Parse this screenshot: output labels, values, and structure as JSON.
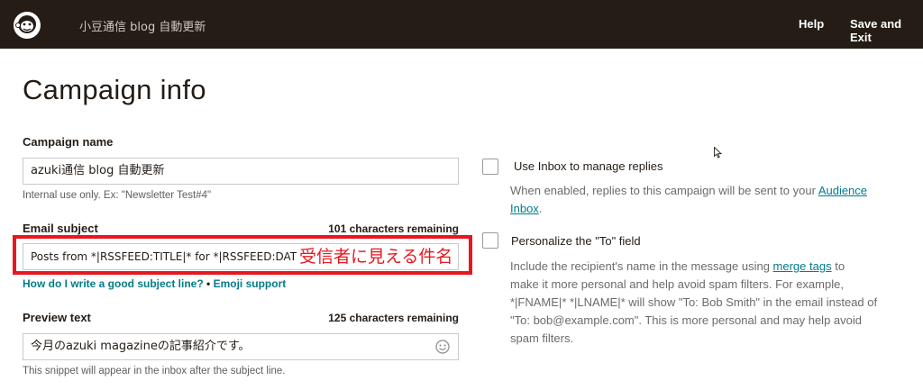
{
  "topbar": {
    "campaign_title": "小豆通信 blog 自動更新",
    "help_label": "Help",
    "save_exit_label": "Save and Exit",
    "logo_icon": "mailchimp-logo-icon"
  },
  "page_title": "Campaign info",
  "campaign_name": {
    "label": "Campaign name",
    "value": "azuki通信 blog 自動更新",
    "help": "Internal use only. Ex: \"Newsletter Test#4\""
  },
  "email_subject": {
    "label": "Email subject",
    "counter": "101 characters remaining",
    "value": "Posts from *|RSSFEED:TITLE|* for *|RSSFEED:DATE|*",
    "annotation": "受信者に見える件名",
    "help_link": "How do I write a good subject line?",
    "separator": " • ",
    "emoji_link": "Emoji support"
  },
  "preview_text": {
    "label": "Preview text",
    "counter": "125 characters remaining",
    "value": "今月のazuki magazineの記事紹介です。",
    "help": "This snippet will appear in the inbox after the subject line."
  },
  "options": {
    "inbox": {
      "label": "Use Inbox to manage replies",
      "desc_line1_pre": "When enabled, replies to this campaign will be sent to your ",
      "desc_link_part1": "Audience",
      "desc_link_part2": "Inbox",
      "desc_line2_post": "."
    },
    "personalize": {
      "label": "Personalize the \"To\" field",
      "desc_line1_pre": "Include the recipient's name in the message using ",
      "desc_link": "merge tags",
      "desc_line1_post": " to",
      "desc_line2": "make it more personal and help avoid spam filters. For example,",
      "desc_line3": "*|FNAME|* *|LNAME|* will show \"To: Bob Smith\" in the email instead of",
      "desc_line4": "\"To: bob@example.com\". This is more personal and may help avoid",
      "desc_line5": "spam filters."
    }
  },
  "colors": {
    "topbar": "#241c15",
    "link": "#007c89",
    "annotation_red": "#e8171f"
  }
}
